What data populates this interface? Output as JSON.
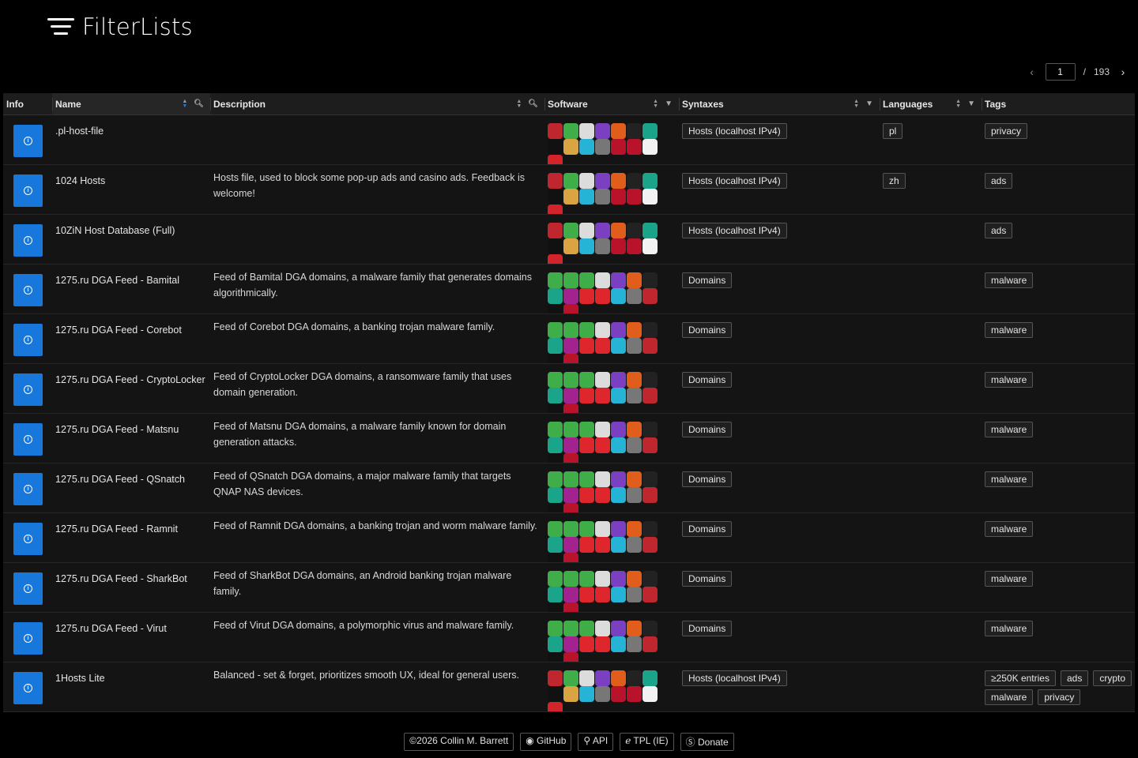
{
  "app": {
    "title": "FilterLists"
  },
  "pager": {
    "current": "1",
    "separator": "/",
    "total": "193"
  },
  "columns": {
    "info": "Info",
    "name": "Name",
    "description": "Description",
    "software": "Software",
    "syntaxes": "Syntaxes",
    "languages": "Languages",
    "tags": "Tags"
  },
  "rows": [
    {
      "name": ".pl-host-file",
      "description": "",
      "syntax": "Hosts (localhost IPv4)",
      "languages": [
        "pl"
      ],
      "tags": [
        "privacy"
      ],
      "sw": "hosts"
    },
    {
      "name": "1024 Hosts",
      "description": "Hosts file, used to block some pop-up ads and casino ads. Feedback is welcome!",
      "syntax": "Hosts (localhost IPv4)",
      "languages": [
        "zh"
      ],
      "tags": [
        "ads"
      ],
      "sw": "hosts"
    },
    {
      "name": "10ZiN Host Database (Full)",
      "description": "",
      "syntax": "Hosts (localhost IPv4)",
      "languages": [],
      "tags": [
        "ads"
      ],
      "sw": "hosts"
    },
    {
      "name": "1275.ru DGA Feed - Bamital",
      "description": "Feed of Bamital DGA domains, a malware family that generates domains algorithmically.",
      "syntax": "Domains",
      "languages": [],
      "tags": [
        "malware"
      ],
      "sw": "domains"
    },
    {
      "name": "1275.ru DGA Feed - Corebot",
      "description": "Feed of Corebot DGA domains, a banking trojan malware family.",
      "syntax": "Domains",
      "languages": [],
      "tags": [
        "malware"
      ],
      "sw": "domains"
    },
    {
      "name": "1275.ru DGA Feed - CryptoLocker",
      "description": "Feed of CryptoLocker DGA domains, a ransomware family that uses domain generation.",
      "syntax": "Domains",
      "languages": [],
      "tags": [
        "malware"
      ],
      "sw": "domains"
    },
    {
      "name": "1275.ru DGA Feed - Matsnu",
      "description": "Feed of Matsnu DGA domains, a malware family known for domain generation attacks.",
      "syntax": "Domains",
      "languages": [],
      "tags": [
        "malware"
      ],
      "sw": "domains"
    },
    {
      "name": "1275.ru DGA Feed - QSnatch",
      "description": "Feed of QSnatch DGA domains, a major malware family that targets QNAP NAS devices.",
      "syntax": "Domains",
      "languages": [],
      "tags": [
        "malware"
      ],
      "sw": "domains"
    },
    {
      "name": "1275.ru DGA Feed - Ramnit",
      "description": "Feed of Ramnit DGA domains, a banking trojan and worm malware family.",
      "syntax": "Domains",
      "languages": [],
      "tags": [
        "malware"
      ],
      "sw": "domains"
    },
    {
      "name": "1275.ru DGA Feed - SharkBot",
      "description": "Feed of SharkBot DGA domains, an Android banking trojan malware family.",
      "syntax": "Domains",
      "languages": [],
      "tags": [
        "malware"
      ],
      "sw": "domains"
    },
    {
      "name": "1275.ru DGA Feed - Virut",
      "description": "Feed of Virut DGA domains, a polymorphic virus and malware family.",
      "syntax": "Domains",
      "languages": [],
      "tags": [
        "malware"
      ],
      "sw": "domains"
    },
    {
      "name": "1Hosts Lite",
      "description": "Balanced - set & forget, prioritizes smooth UX, ideal for general users.",
      "syntax": "Hosts (localhost IPv4)",
      "languages": [],
      "tags": [
        "≥250K entries",
        "ads",
        "crypto",
        "malware",
        "privacy"
      ],
      "sw": "hosts"
    }
  ],
  "software_icons": {
    "hosts": [
      "#c0262d",
      "#3fae49",
      "#dcdcdc",
      "#7b3fc1",
      "#e05d1b",
      "#222",
      "#1aa58a",
      "#111",
      "#d9a441",
      "#25b3d6",
      "#777",
      "#b8132b",
      "#b8132b",
      "#f2f2f2",
      "#d4242b"
    ],
    "domains": [
      "#3fae49",
      "#3fae49",
      "#3fae49",
      "#dcdcdc",
      "#7b3fc1",
      "#e05d1b",
      "#222",
      "#1aa58a",
      "#a2238f",
      "#e0262d",
      "#e0262d",
      "#25b3d6",
      "#777",
      "#c0262d",
      "#111",
      "#b8132b"
    ]
  },
  "footer": {
    "copyright": "©2026 Collin M. Barrett",
    "github": "GitHub",
    "api": "API",
    "tpl": "TPL (IE)",
    "donate": "Donate"
  }
}
